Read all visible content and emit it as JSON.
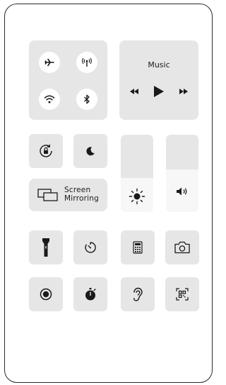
{
  "connectivity": {
    "airplane": "airplane-mode",
    "cellular": "cellular-data",
    "wifi": "wifi",
    "bluetooth": "bluetooth"
  },
  "music": {
    "title": "Music",
    "controls": [
      "rewind",
      "play",
      "fast-forward"
    ]
  },
  "screen_mirroring": {
    "label_line1": "Screen",
    "label_line2": "Mirroring"
  },
  "sliders": {
    "brightness_level": 0.44,
    "volume_level": 0.55
  },
  "toggles": [
    "rotation-lock",
    "do-not-disturb"
  ],
  "shortcuts_row1": [
    "flashlight",
    "timer",
    "calculator",
    "camera"
  ],
  "shortcuts_row2": [
    "screen-recording",
    "stopwatch",
    "hearing",
    "qr-code-scanner"
  ],
  "colors": {
    "tile": "#e6e6e6",
    "tile_light": "#f7f7f7",
    "icon": "#1a1a1a",
    "frame_border": "#2a2a2a"
  }
}
